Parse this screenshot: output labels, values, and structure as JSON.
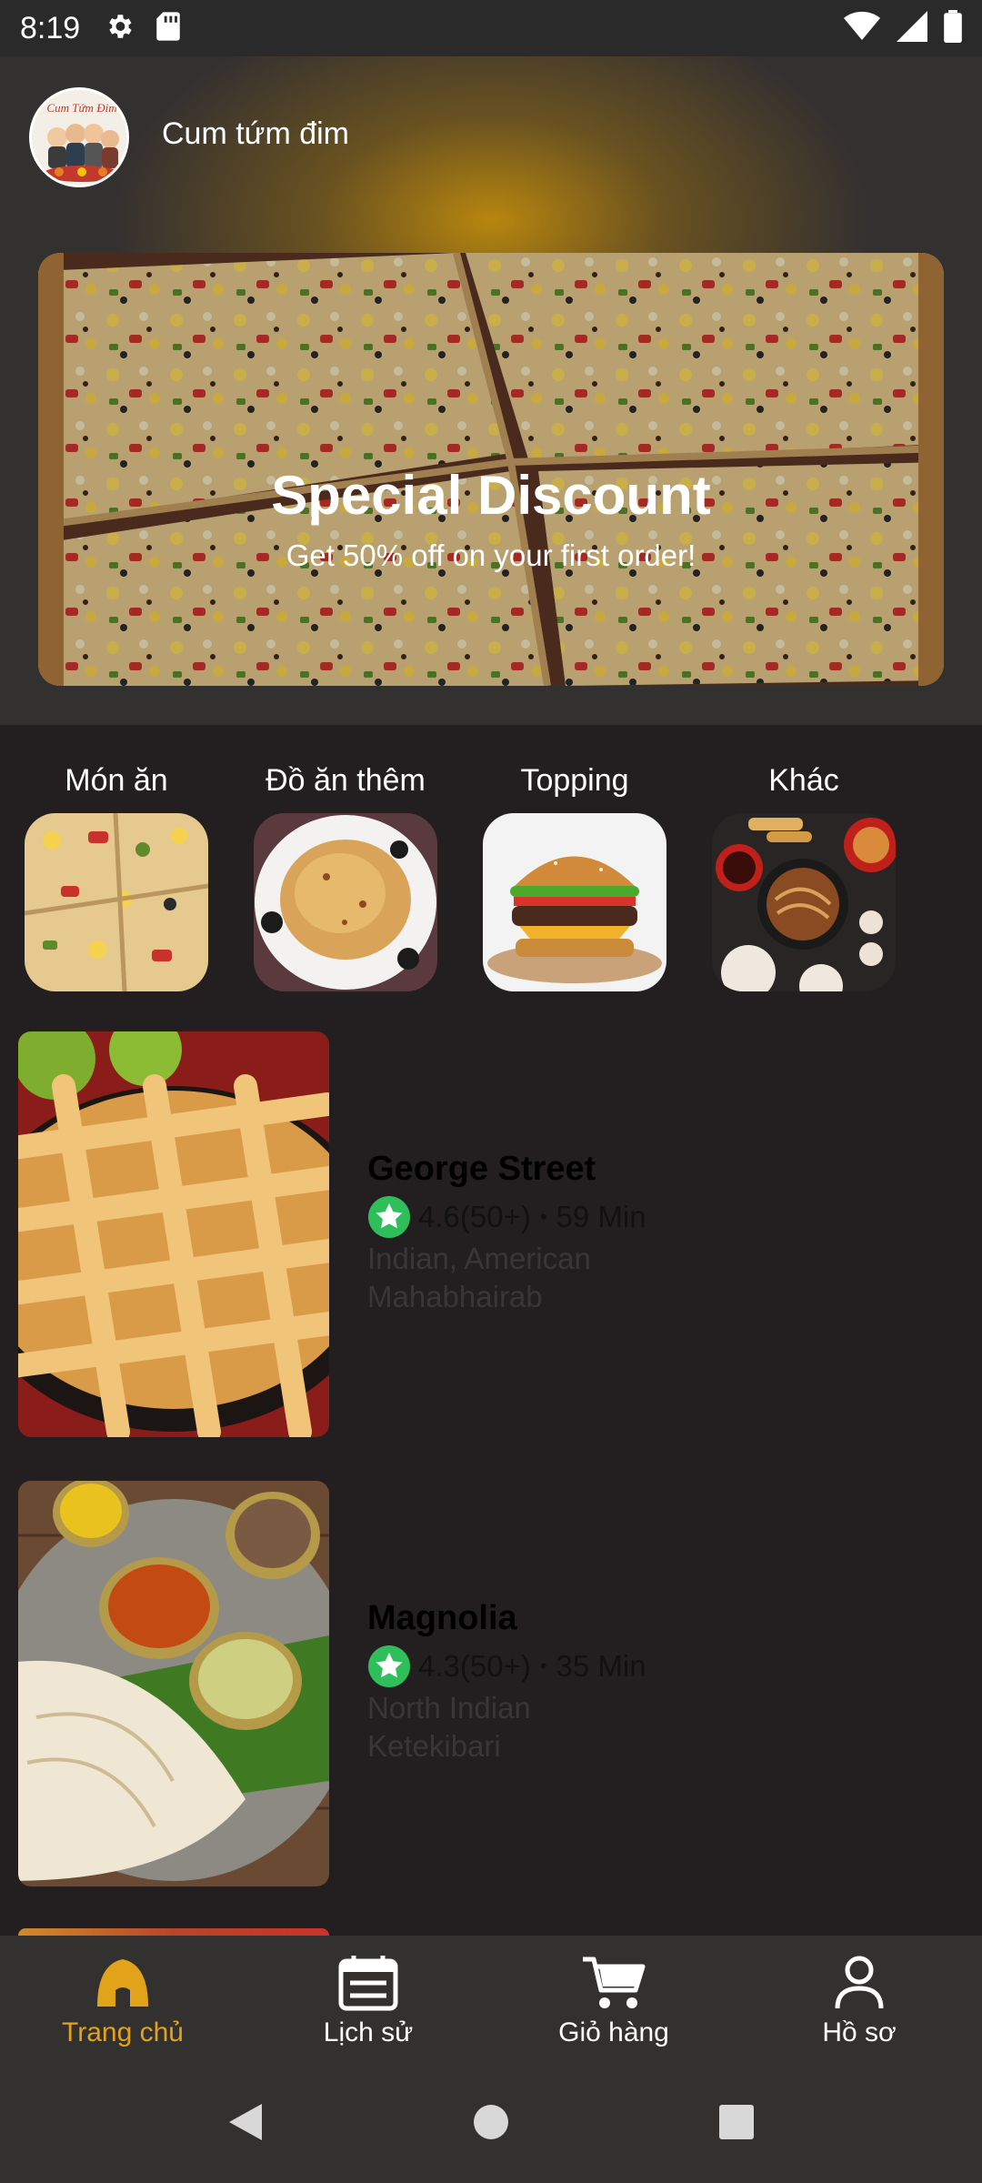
{
  "status_bar": {
    "time": "8:19",
    "icons": [
      "gear-icon",
      "sd-card-icon",
      "wifi-icon",
      "signal-icon",
      "battery-icon"
    ]
  },
  "header": {
    "app_name": "Cum tứm đim",
    "avatar_icon": "group-logo",
    "accent_color": "#b8860f"
  },
  "banner": {
    "title": "Special Discount",
    "subtitle": "Get 50% off on your first order!"
  },
  "categories": [
    {
      "label": "Món ăn",
      "image": "pizza"
    },
    {
      "label": "Đồ ăn thêm",
      "image": "fried-rice"
    },
    {
      "label": "Topping",
      "image": "burger"
    },
    {
      "label": "Khác",
      "image": "noodles-platter"
    }
  ],
  "restaurants": [
    {
      "name": "George Street",
      "rating": "4.6(50+)",
      "separator": "•",
      "time": "59 Min",
      "cuisine": "Indian, American",
      "location": "Mahabhairab",
      "image": "apple-pie"
    },
    {
      "name": "Magnolia",
      "rating": "4.3(50+)",
      "separator": "•",
      "time": "35 Min",
      "cuisine": "North Indian",
      "location": "Ketekibari",
      "image": "dosa-thali"
    }
  ],
  "bottom_nav": [
    {
      "label": "Trang chủ",
      "icon": "home-icon",
      "active": true
    },
    {
      "label": "Lịch sử",
      "icon": "calendar-icon",
      "active": false
    },
    {
      "label": "Giỏ hàng",
      "icon": "cart-icon",
      "active": false
    },
    {
      "label": "Hồ sơ",
      "icon": "person-icon",
      "active": false
    }
  ],
  "colors": {
    "background": "#231f20",
    "surface": "#333030",
    "active_nav": "#e2a21a",
    "rating_star": "#2fbf5a"
  }
}
